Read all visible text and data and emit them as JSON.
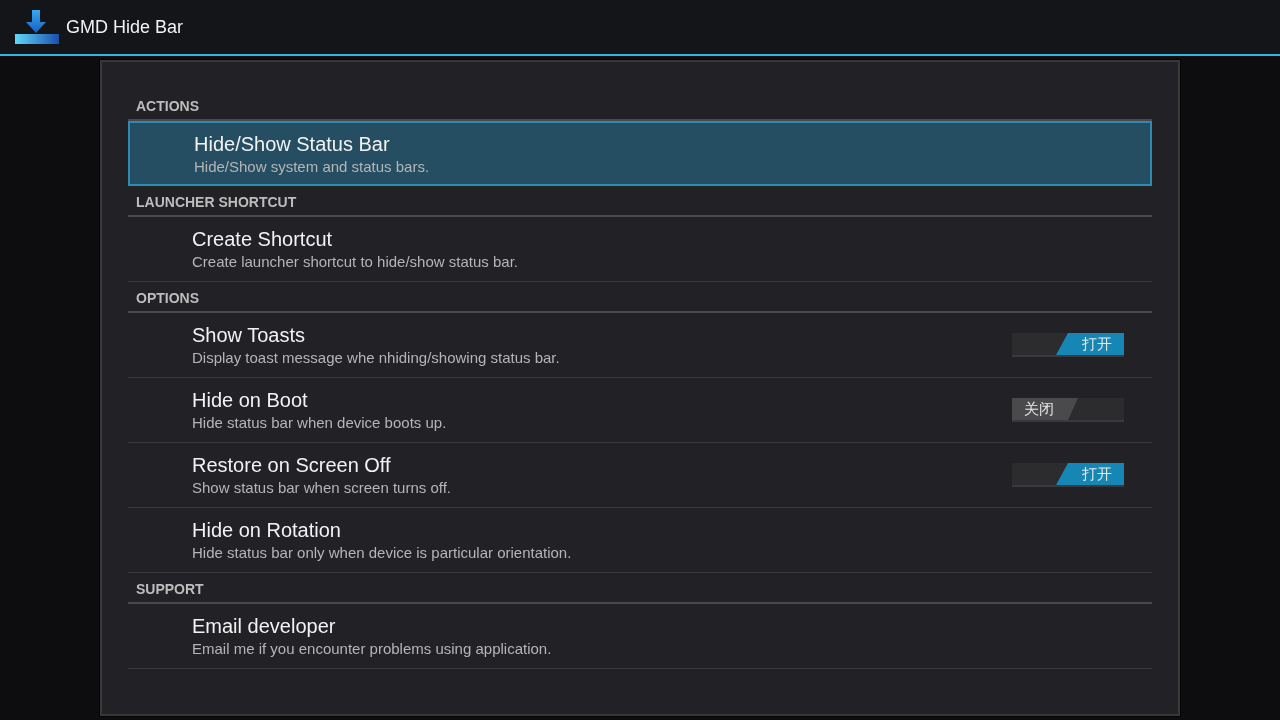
{
  "app_bar": {
    "title": "GMD Hide Bar"
  },
  "sections": [
    {
      "header": "ACTIONS",
      "items": [
        {
          "kind": "action",
          "title": "Hide/Show Status Bar",
          "summary": "Hide/Show system and status bars.",
          "selected": true
        }
      ]
    },
    {
      "header": "LAUNCHER SHORTCUT",
      "items": [
        {
          "kind": "action",
          "title": "Create Shortcut",
          "summary": "Create launcher shortcut to hide/show status bar.",
          "selected": false
        }
      ]
    },
    {
      "header": "OPTIONS",
      "items": [
        {
          "kind": "toggle",
          "title": "Show Toasts",
          "summary": "Display toast message whe nhiding/showing status bar.",
          "selected": false,
          "on": true,
          "switch_label": "打开"
        },
        {
          "kind": "toggle",
          "title": "Hide on Boot",
          "summary": "Hide status bar when device boots up.",
          "selected": false,
          "on": false,
          "switch_label": "关闭"
        },
        {
          "kind": "toggle",
          "title": "Restore on Screen Off",
          "summary": "Show status bar when screen turns off.",
          "selected": false,
          "on": true,
          "switch_label": "打开"
        },
        {
          "kind": "action",
          "title": "Hide on Rotation",
          "summary": "Hide status bar only when device is particular orientation.",
          "selected": false
        }
      ]
    },
    {
      "header": "SUPPORT",
      "items": [
        {
          "kind": "action",
          "title": "Email developer",
          "summary": "Email me if you encounter problems using application.",
          "selected": false
        }
      ]
    }
  ]
}
